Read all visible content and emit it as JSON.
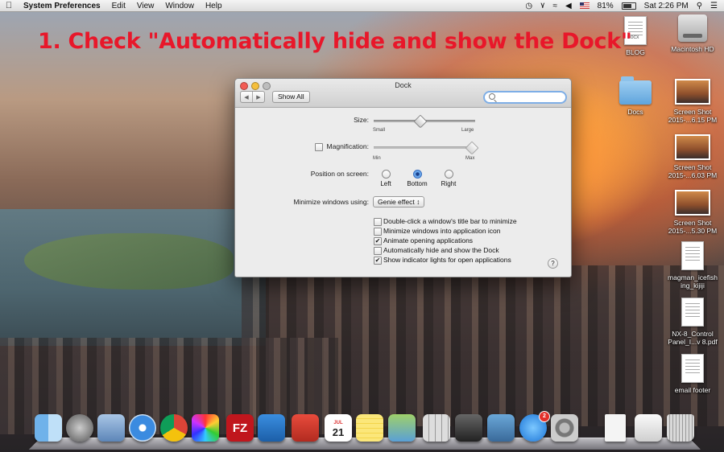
{
  "menubar": {
    "app_name": "System Preferences",
    "menus": [
      "Edit",
      "View",
      "Window",
      "Help"
    ],
    "battery": "81%",
    "clock": "Sat 2:26 PM"
  },
  "instruction": "1. Check \"Automatically hide and show the Dock\"",
  "desktop_icons": {
    "blog": "BLOG",
    "blog_doc_tag": "DOCX",
    "macintosh_hd": "Macintosh HD",
    "docs": "Docs",
    "shot1_line1": "Screen Shot",
    "shot1_line2": "2015-...6.15 PM",
    "shot2_line1": "Screen Shot",
    "shot2_line2": "2015-...6.03 PM",
    "shot3_line1": "Screen Shot",
    "shot3_line2": "2015-...5.30 PM",
    "magman_line1": "magman_icefish",
    "magman_line2": "ing_kijiji",
    "nx_line1": "NX-8_Control",
    "nx_line2": "Panel_I...v 8.pdf",
    "email_footer": "email footer"
  },
  "window": {
    "title": "Dock",
    "show_all": "Show All",
    "back_icon": "◀",
    "forward_icon": "▶",
    "size_label": "Size:",
    "size_small": "Small",
    "size_large": "Large",
    "size_value": 0.45,
    "magnification_label": "Magnification:",
    "magnification_checked": false,
    "mag_min": "Min",
    "mag_max": "Max",
    "magnification_value": 1.0,
    "position_label": "Position on screen:",
    "position_left": "Left",
    "position_bottom": "Bottom",
    "position_right": "Right",
    "position_selected": "Bottom",
    "minimize_label": "Minimize windows using:",
    "minimize_value": "Genie effect",
    "options": [
      {
        "label": "Double-click a window's title bar to minimize",
        "checked": false
      },
      {
        "label": "Minimize windows into application icon",
        "checked": false
      },
      {
        "label": "Animate opening applications",
        "checked": true
      },
      {
        "label": "Automatically hide and show the Dock",
        "checked": false
      },
      {
        "label": "Show indicator lights for open applications",
        "checked": true
      }
    ],
    "help": "?"
  },
  "dock": {
    "calendar_month": "JUL",
    "calendar_day": "21",
    "filezilla": "FZ",
    "app_store_badge": "2"
  }
}
